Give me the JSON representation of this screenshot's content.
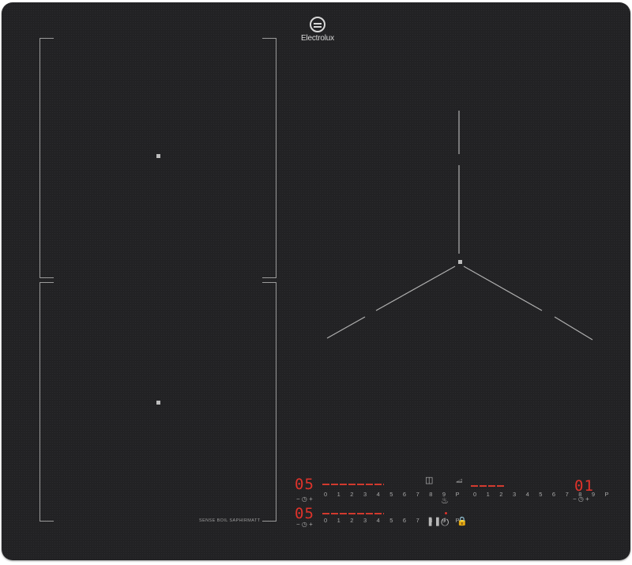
{
  "brand": {
    "name": "Electrolux"
  },
  "model_label": "SENSE BOIL SAPHIRMATT",
  "zones": {
    "front_left": {
      "display": "05"
    },
    "rear_left": {
      "display": "05"
    },
    "right": {
      "display": "01"
    }
  },
  "power_scale": [
    "0",
    "1",
    "2",
    "3",
    "4",
    "5",
    "6",
    "7",
    "8",
    "9",
    "P"
  ],
  "power_scale_text": "0 1 2 3 4 5 6 7 8 9 P",
  "timer_controls": {
    "minus": "−",
    "plus": "+"
  },
  "icons": {
    "bridge": "bridge-icon",
    "hob2hood": "hob2hood-icon",
    "keep_warm": "keep-warm-icon",
    "pause": "pause-icon",
    "power": "power-icon",
    "lock": "lock-icon",
    "timer": "timer-icon"
  },
  "colors": {
    "glass": "#222224",
    "display_red": "#e0332b",
    "marking": "#9a9a9a"
  }
}
